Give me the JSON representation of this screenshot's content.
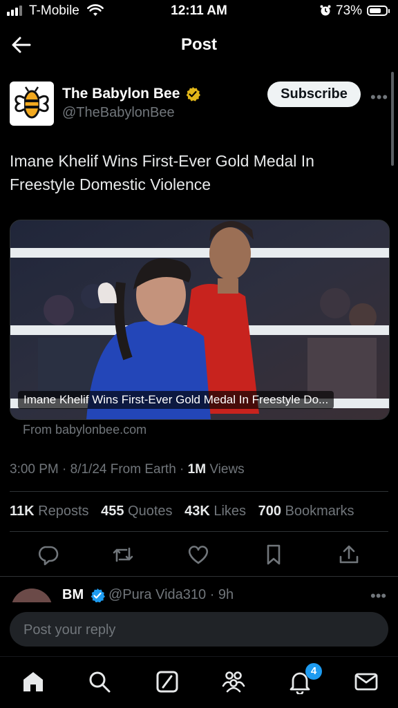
{
  "status_bar": {
    "carrier": "T-Mobile",
    "time": "12:11 AM",
    "battery_percent": "73%",
    "battery_level": 0.73,
    "icons": [
      "signal-icon",
      "wifi-icon",
      "alarm-icon",
      "battery-icon"
    ]
  },
  "header": {
    "title": "Post",
    "back_icon": "arrow-left-icon"
  },
  "post": {
    "author_name": "The Babylon Bee",
    "author_handle": "@TheBabylonBee",
    "subscribe_label": "Subscribe",
    "more_label": "•••",
    "text": "Imane Khelif Wins First-Ever Gold Medal In Freestyle Domestic Violence",
    "card_caption": "Imane Khelif Wins First-Ever Gold Medal In Freestyle Do...",
    "card_source": "From babylonbee.com",
    "timestamp": "3:00 PM · 8/1/24 From Earth · ",
    "views_count": "1M",
    "views_label": " Views",
    "stats": [
      {
        "count": "11K",
        "label": " Reposts"
      },
      {
        "count": "455",
        "label": " Quotes"
      },
      {
        "count": "43K",
        "label": " Likes"
      },
      {
        "count": "700",
        "label": " Bookmarks"
      }
    ],
    "actions": [
      "reply-icon",
      "repost-icon",
      "like-icon",
      "bookmark-icon",
      "share-icon"
    ]
  },
  "reply_preview": {
    "name": "BM",
    "handle": "@Pura Vida310 · 9h",
    "more_label": "•••"
  },
  "composer": {
    "placeholder": "Post your reply"
  },
  "tabbar": {
    "items": [
      "home-icon",
      "search-icon",
      "grok-icon",
      "communities-icon",
      "notifications-icon",
      "messages-icon"
    ],
    "notifications_badge": "4"
  },
  "colors": {
    "background": "#000000",
    "text_primary": "#e7e9ea",
    "text_secondary": "#71767b",
    "accent": "#1d9bf0",
    "verified_gold": "#e2b719",
    "divider": "#2f3336"
  }
}
